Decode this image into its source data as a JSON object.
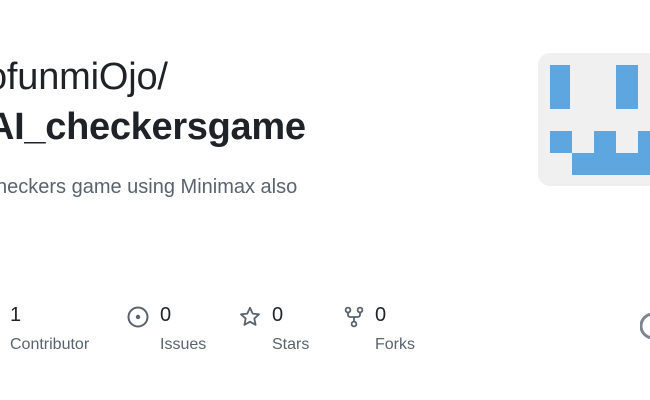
{
  "repo": {
    "owner_text": "ofunmiOjo/",
    "name_text": "AI_checkersgame",
    "description": "checkers game using Minimax also"
  },
  "avatar": {
    "icon": "identicon",
    "color": "#5ea6df",
    "background": "#f0f0f0"
  },
  "stats": [
    {
      "icon": "people-icon",
      "value": "1",
      "label": "Contributor"
    },
    {
      "icon": "issue-icon",
      "value": "0",
      "label": "Issues"
    },
    {
      "icon": "star-icon",
      "value": "0",
      "label": "Stars"
    },
    {
      "icon": "fork-icon",
      "value": "0",
      "label": "Forks"
    }
  ],
  "edge_logo": {
    "icon": "github-logo-icon"
  }
}
